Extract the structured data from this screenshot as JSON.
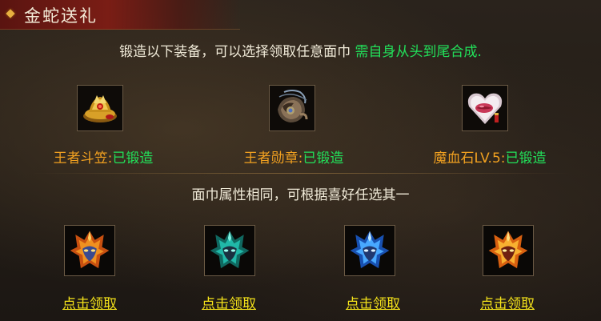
{
  "header": {
    "title": "金蛇送礼"
  },
  "intro": {
    "text_plain": "锻造以下装备，可以选择领取任意面巾",
    "text_green": "需自身从头到尾合成."
  },
  "equipment": [
    {
      "name": "王者斗笠",
      "status": "已锻造",
      "icon": "golden-hat-icon"
    },
    {
      "name": "王者勋章",
      "status": "已锻造",
      "icon": "medal-icon"
    },
    {
      "name": "魔血石LV.5",
      "status": "已锻造",
      "icon": "blood-stone-icon"
    }
  ],
  "mask_note": "面巾属性相同，可根据喜好任选其一",
  "masks": [
    {
      "icon": "fire-mask-icon",
      "label": "点击领取",
      "color": "#e07020"
    },
    {
      "icon": "teal-mask-icon",
      "label": "点击领取",
      "color": "#20c8b0"
    },
    {
      "icon": "ice-mask-icon",
      "label": "点击领取",
      "color": "#40a8ff"
    },
    {
      "icon": "flame-mask-icon",
      "label": "点击领取",
      "color": "#f0a030"
    }
  ],
  "colors": {
    "accent_orange": "#f0a020",
    "status_green": "#22e05a",
    "link_yellow": "#f2e01a"
  }
}
